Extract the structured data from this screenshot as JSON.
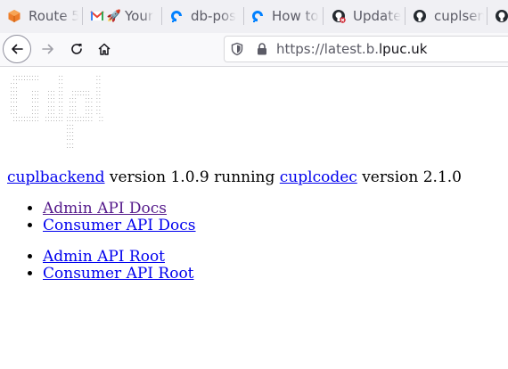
{
  "browser": {
    "tabs": [
      {
        "label": "Route 5",
        "icon": "aws-route53-icon"
      },
      {
        "label": "Your",
        "icon": "gmail-icon"
      },
      {
        "label": "db-pos",
        "icon": "digitalocean-icon"
      },
      {
        "label": "How to",
        "icon": "digitalocean-icon"
      },
      {
        "label": "Update",
        "icon": "github-failed-icon"
      },
      {
        "label": "cuplsen",
        "icon": "github-icon"
      },
      {
        "label": "",
        "icon": "github-icon"
      }
    ],
    "url": {
      "prefix": "https://latest.b.",
      "domain": "lpuc.uk"
    }
  },
  "page": {
    "logo_ascii": "  ..........       ..            ..  \n  ..........       ..            ..  \n ...               ..            ..  \n ...               ..            ..  \n ...     ...   ... ..   .......  ..  \n ...     ...   ... ..   .......  ..  \n ...     ...   ... ..  ...   ... ..  \n ...     ...   ... ..  ...   ... ..  \n ...     ...   ... ..  ...   ... ..  \n ...     ...   ... ..  ...   ... ..  \n ...     ...   ... ..  ...   ... ..  \n  ..........  ....... ..........  .. \n  ..........  ....... ..........  .. \n                      ...            \n                      ...            \n                      ...            \n                      ...            \n                      ...            \n                      ...            \n                      ...            ",
    "backend_link": "cuplbackend",
    "version_text_1": " version 1.0.9 running ",
    "codec_link": "cuplcodec",
    "version_text_2": " version 2.1.0",
    "doc_links": [
      "Admin API Docs",
      "Consumer API Docs"
    ],
    "root_links": [
      "Admin API Root",
      "Consumer API Root"
    ]
  },
  "colors": {
    "link": "#0000ee",
    "visited_link": "#551a8b",
    "logo": "#6a6a6a"
  }
}
